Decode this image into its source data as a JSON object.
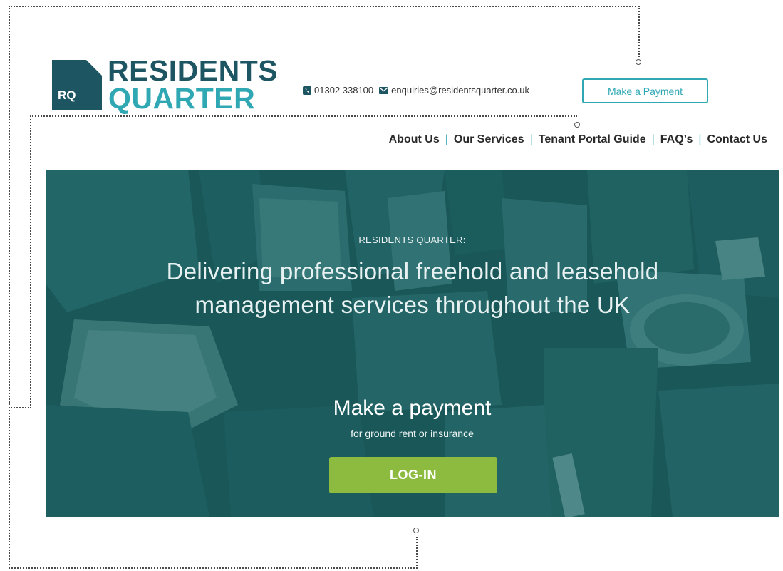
{
  "logo": {
    "line1": "RESIDENTS",
    "line2": "QUARTER",
    "mark_text": "RQ"
  },
  "contact": {
    "phone": "01302 338100",
    "email": "enquiries@residentsquarter.co.uk"
  },
  "header": {
    "payment_button": "Make a Payment"
  },
  "nav": {
    "items": [
      "About Us",
      "Our Services",
      "Tenant Portal Guide",
      "FAQ’s",
      "Contact Us"
    ],
    "separator": "|"
  },
  "hero": {
    "kicker": "RESIDENTS QUARTER:",
    "title": "Delivering professional freehold and leasehold management services throughout the UK",
    "payment_heading": "Make a payment",
    "payment_sub": "for ground rent or insurance",
    "login_button": "LOG-IN"
  },
  "colors": {
    "brand_dark": "#1d5563",
    "brand_teal": "#30a8b4",
    "login_green": "#8cbb3f"
  },
  "icons": [
    "phone-icon",
    "envelope-icon"
  ]
}
